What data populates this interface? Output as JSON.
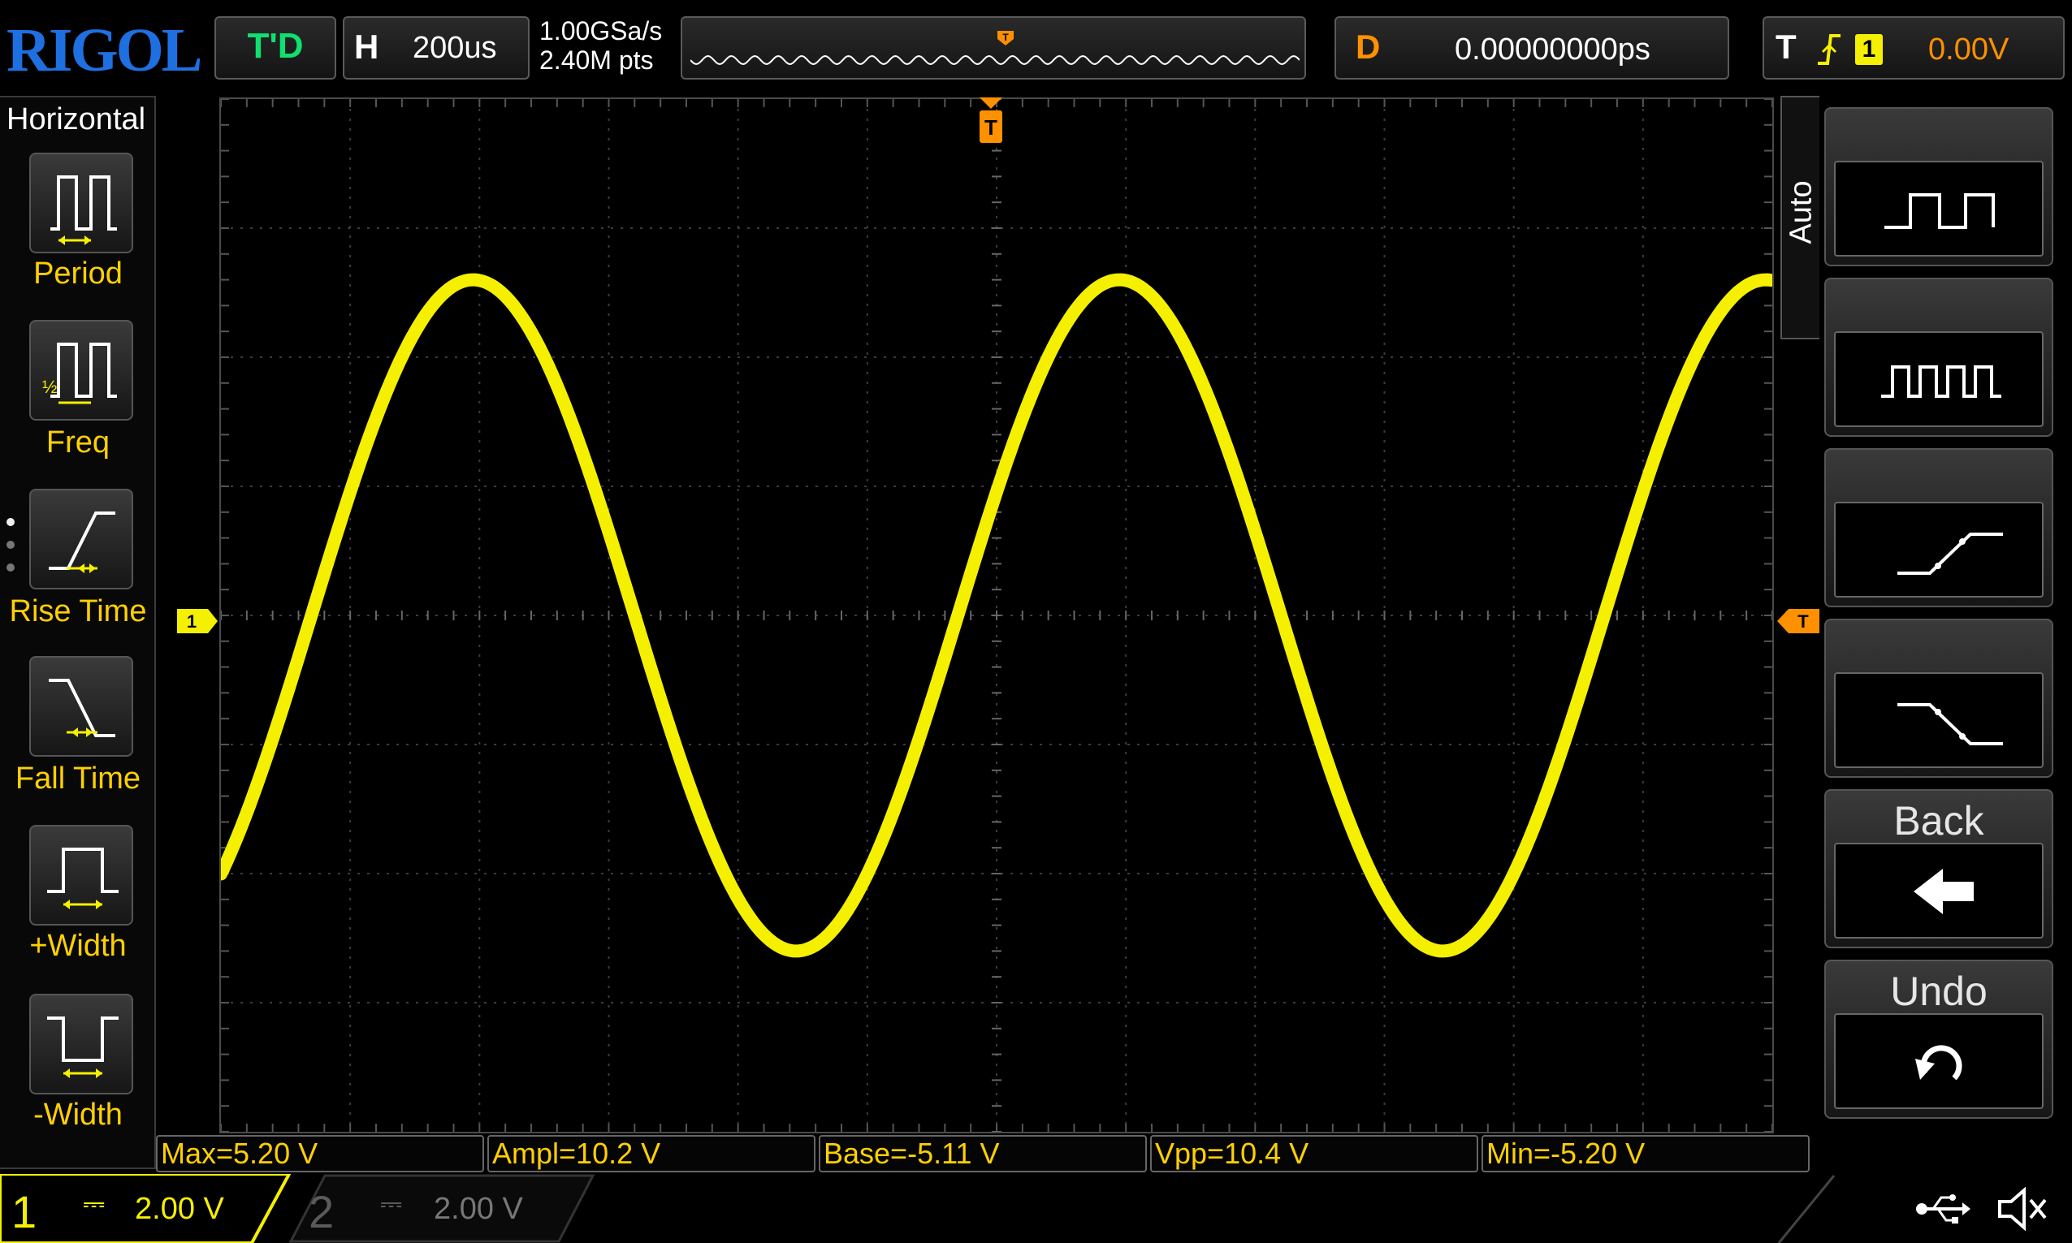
{
  "brand": "RIGOL",
  "status": {
    "run_mode": "T'D",
    "horizontal_letter": "H",
    "timebase": "200us",
    "sample_rate": "1.00GSa/s",
    "memory_depth": "2.40M pts",
    "delay_letter": "D",
    "delay_value": "0.00000000ps",
    "trigger_letter": "T",
    "trigger_source": "1",
    "trigger_level": "0.00V"
  },
  "left_menu": {
    "title": "Horizontal",
    "items": [
      {
        "label": "Period",
        "icon": "period-icon"
      },
      {
        "label": "Freq",
        "icon": "freq-icon"
      },
      {
        "label": "Rise Time",
        "icon": "rise-time-icon"
      },
      {
        "label": "Fall Time",
        "icon": "fall-time-icon"
      },
      {
        "label": "+Width",
        "icon": "positive-width-icon"
      },
      {
        "label": "-Width",
        "icon": "negative-width-icon"
      }
    ]
  },
  "right_menu": {
    "auto_tab": "Auto",
    "items": [
      {
        "label": "",
        "icon": "single-pulse-icon"
      },
      {
        "label": "",
        "icon": "pulse-train-icon"
      },
      {
        "label": "",
        "icon": "rising-edge-icon"
      },
      {
        "label": "",
        "icon": "falling-edge-icon"
      },
      {
        "label": "Back",
        "icon": "back-arrow-icon"
      },
      {
        "label": "Undo",
        "icon": "undo-icon"
      }
    ]
  },
  "markers": {
    "channel1": "1",
    "trigger": "T"
  },
  "measurements": [
    {
      "label": "Max=5.20 V"
    },
    {
      "label": "Ampl=10.2 V"
    },
    {
      "label": "Base=-5.11 V"
    },
    {
      "label": "Vpp=10.4 V"
    },
    {
      "label": "Min=-5.20 V"
    }
  ],
  "channels": [
    {
      "number": "1",
      "scale": "2.00 V",
      "active": true,
      "color": "#f5f000"
    },
    {
      "number": "2",
      "scale": "2.00 V",
      "active": false,
      "color": "#5a5a5a"
    }
  ],
  "colors": {
    "trace": "#f5f000",
    "trigger": "#ff9000",
    "run_status": "#10e070",
    "brand": "#1e6fe0",
    "menu_label": "#ffd000"
  },
  "waveform": {
    "type": "sine",
    "timebase_per_div": "200us",
    "volts_per_div": "2.00 V",
    "max_v": 5.2,
    "min_v": -5.2,
    "cycles_on_screen": 2.4
  }
}
